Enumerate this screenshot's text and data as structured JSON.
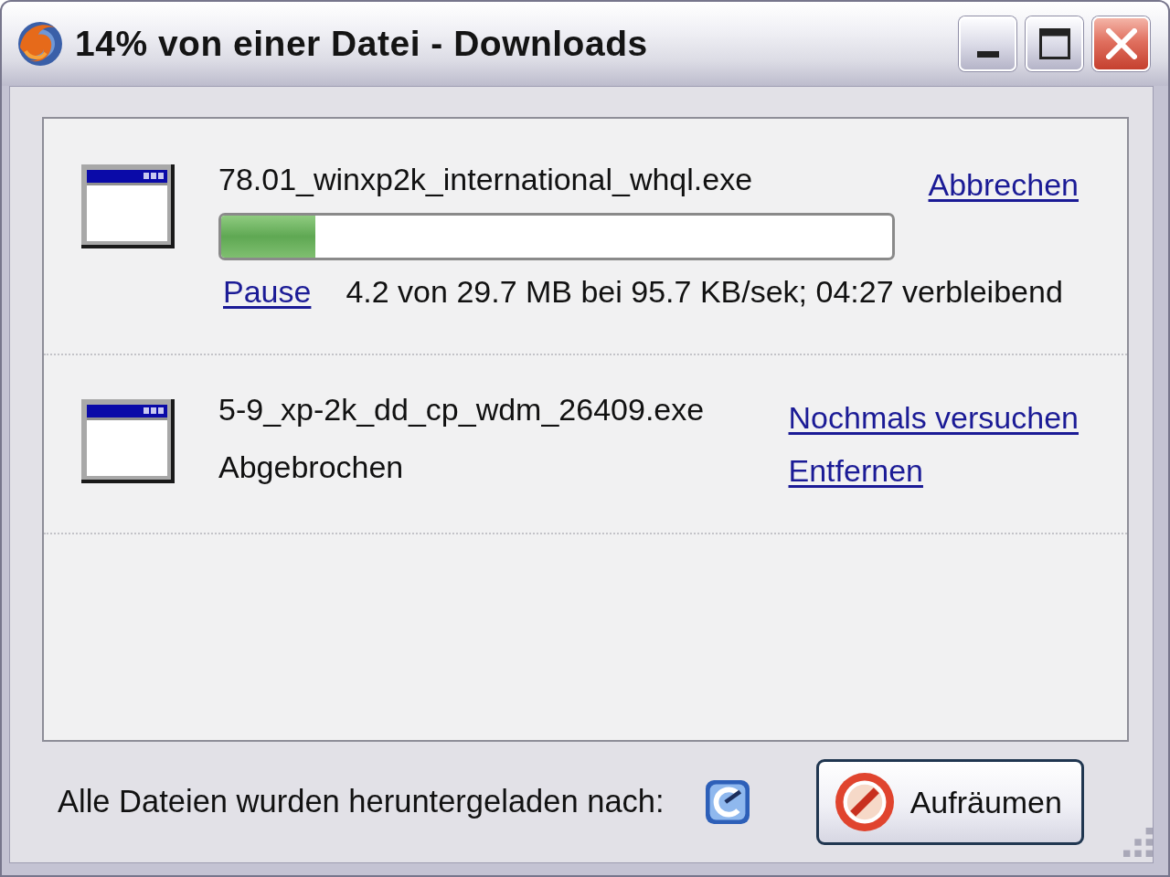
{
  "window": {
    "title": "14% von einer Datei - Downloads"
  },
  "downloads": [
    {
      "kind": "in_progress",
      "filename": "78.01_winxp2k_international_whql.exe",
      "actions": [
        "Abbrechen"
      ],
      "level": 0.14,
      "pause_link": "Pause",
      "status": "4.2 von 29.7 MB bei 95.7 KB/sek; 04:27 verbleibend"
    },
    {
      "kind": "canceled",
      "filename": "5-9_xp-2k_dd_cp_wdm_26409.exe",
      "status": "Abgebrochen",
      "actions": [
        "Nochmals versuchen",
        "Entfernen"
      ]
    }
  ],
  "footer": {
    "label": "Alle Dateien wurden heruntergeladen nach:",
    "button": "Aufräumen"
  }
}
